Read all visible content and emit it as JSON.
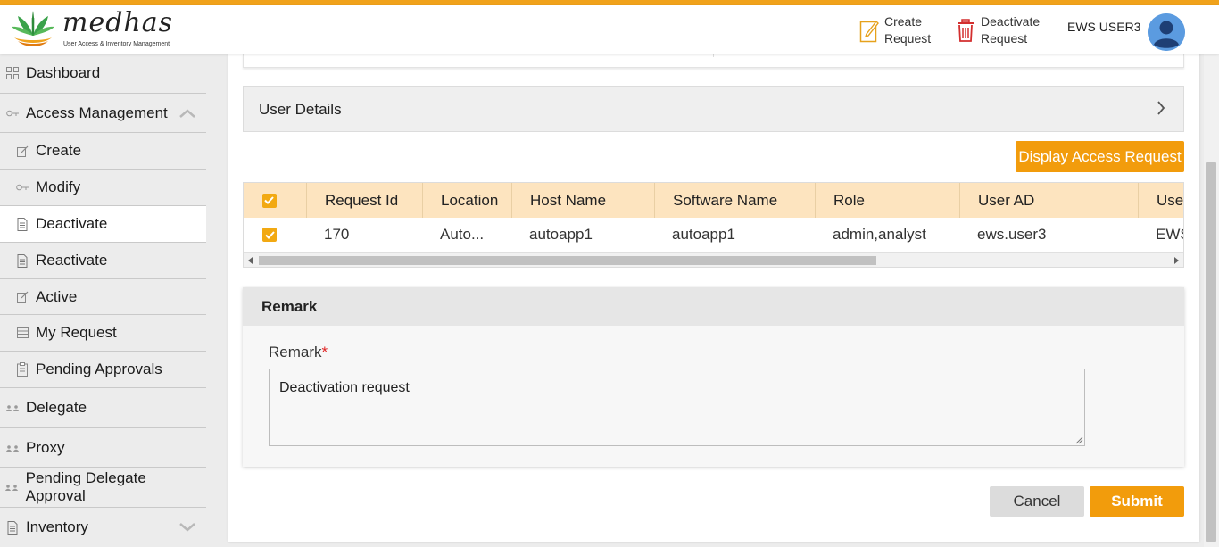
{
  "header": {
    "logo_text": "medhas",
    "logo_tagline": "User Access & Inventory Management",
    "create_request": [
      "Create",
      "Request"
    ],
    "deactivate_request": [
      "Deactivate",
      "Request"
    ],
    "user_name": "EWS USER3",
    "accent_color": "#f0a21b"
  },
  "sidebar": {
    "items": [
      {
        "label": "Dashboard",
        "icon": "grid-icon"
      },
      {
        "label": "Access Management",
        "icon": "key-icon"
      },
      {
        "label": "Create",
        "icon": "edit-icon"
      },
      {
        "label": "Modify",
        "icon": "key-icon"
      },
      {
        "label": "Deactivate",
        "icon": "document-icon"
      },
      {
        "label": "Reactivate",
        "icon": "document-icon"
      },
      {
        "label": "Active",
        "icon": "edit-icon"
      },
      {
        "label": "My Request",
        "icon": "table-icon"
      },
      {
        "label": "Pending Approvals",
        "icon": "clipboard-icon"
      },
      {
        "label": "Delegate",
        "icon": "delegate-icon"
      },
      {
        "label": "Proxy",
        "icon": "delegate-icon"
      },
      {
        "label": "Pending Delegate Approval",
        "icon": "delegate-icon"
      },
      {
        "label": "Inventory",
        "icon": "document-icon"
      }
    ],
    "active_item": "Deactivate"
  },
  "main": {
    "user_details_title": "User Details",
    "display_button": "Display Access Request",
    "table": {
      "headers": [
        "Request Id",
        "Location",
        "Host Name",
        "Software Name",
        "Role",
        "User AD",
        "User"
      ],
      "header_visible": [
        "Request Id",
        "Location",
        "Host Name",
        "Software Name",
        "Role",
        "User AD",
        "Use"
      ],
      "rows": [
        {
          "checked": true,
          "cells": [
            "170",
            "Auto...",
            "autoapp1",
            "autoapp1",
            "admin,analyst",
            "ews.user3",
            "EWS"
          ]
        }
      ]
    },
    "remark": {
      "section_title": "Remark",
      "label": "Remark",
      "required_mark": "*",
      "value": "Deactivation request"
    },
    "cancel_button": "Cancel",
    "submit_button": "Submit"
  }
}
